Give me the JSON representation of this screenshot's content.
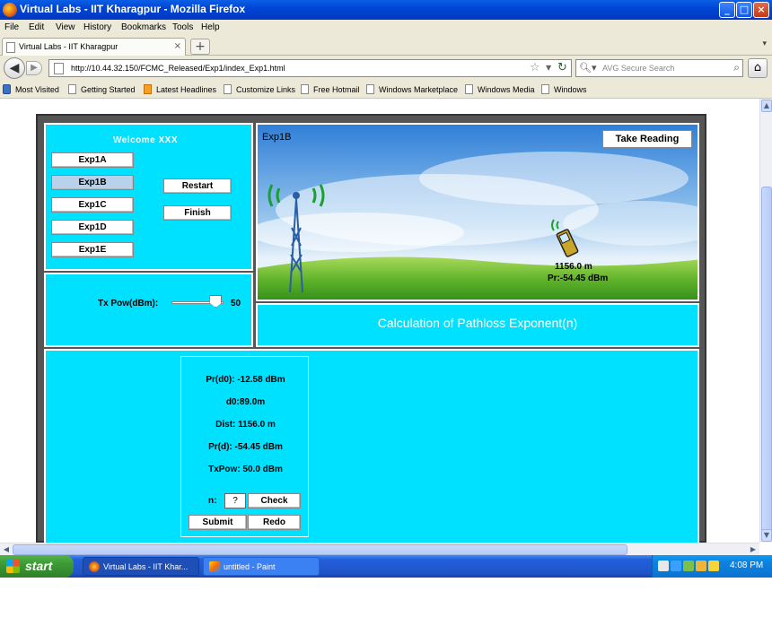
{
  "window": {
    "title": "Virtual Labs - IIT Kharagpur - Mozilla Firefox",
    "minimize_glyph": "_",
    "maximize_glyph": "□",
    "close_glyph": "×"
  },
  "menu": [
    "File",
    "Edit",
    "View",
    "History",
    "Bookmarks",
    "Tools",
    "Help"
  ],
  "tab": {
    "label": "Virtual Labs - IIT Kharagpur",
    "close": "×",
    "new_tab": "+"
  },
  "nav": {
    "url": "http://10.44.32.150/FCMC_Released/Exp1/index_Exp1.html",
    "search_placeholder": "AVG Secure Search"
  },
  "bookmarks": [
    "Most Visited",
    "Getting Started",
    "Latest Headlines",
    "Customize Links",
    "Free Hotmail",
    "Windows Marketplace",
    "Windows Media",
    "Windows"
  ],
  "app": {
    "welcome": "Welcome  XXX",
    "experiments": [
      "Exp1A",
      "Exp1B",
      "Exp1C",
      "Exp1D",
      "Exp1E"
    ],
    "selected_experiment": "Exp1B",
    "restart_label": "Restart",
    "finish_label": "Finish",
    "tx_power_label": "Tx Pow(dBm):",
    "tx_power_value": "50",
    "tx_power_slider_fraction": 0.85,
    "scene_title": "Exp1B",
    "take_reading_label": "Take Reading",
    "phone_distance": "1156.0 m",
    "phone_received": "Pr:-54.45 dBm",
    "calc_title": "Calculation of Pathloss Exponent(n)",
    "readings": [
      "Pr(d0): -12.58 dBm",
      "d0:89.0m",
      "Dist: 1156.0 m",
      "Pr(d): -54.45 dBm",
      "TxPow: 50.0 dBm"
    ],
    "n_label": "n:",
    "n_value": "?",
    "check_label": "Check",
    "submit_label": "Submit",
    "redo_label": "Redo"
  },
  "taskbar": {
    "start_label": "start",
    "tasks": [
      "Virtual Labs - IIT Khar...",
      "untitled - Paint"
    ],
    "clock": "4:08 PM"
  }
}
